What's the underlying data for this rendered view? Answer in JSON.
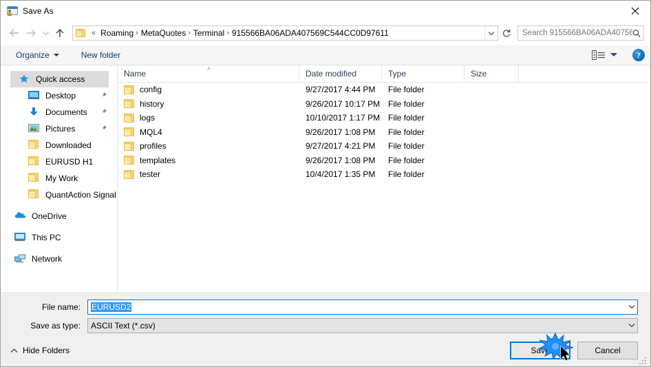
{
  "window": {
    "title": "Save As",
    "icon": "save-as-icon",
    "close_label": "✕"
  },
  "navigation": {
    "back_icon": "arrow-left-icon",
    "forward_icon": "arrow-right-icon",
    "recent_icon": "chevron-down-icon",
    "up_icon": "arrow-up-icon",
    "address": {
      "folder_icon": "folder-icon",
      "prefix": "«",
      "crumbs": [
        "Roaming",
        "MetaQuotes",
        "Terminal",
        "915566BA06ADA407569C544CC0D97611"
      ],
      "separator": "›",
      "dropdown_icon": "chevron-down-icon"
    },
    "refresh_icon": "refresh-icon",
    "search": {
      "placeholder": "Search 915566BA06ADA40756...",
      "icon": "search-icon"
    }
  },
  "toolbar": {
    "organize_label": "Organize",
    "new_folder_label": "New folder",
    "view_icon": "view-details-icon",
    "view_dropdown_icon": "chevron-down-icon",
    "help_label": "?"
  },
  "sidebar": {
    "items": [
      {
        "label": "Quick access",
        "icon": "star-icon",
        "selected": true,
        "indent": false,
        "pinned": false
      },
      {
        "label": "Desktop",
        "icon": "desktop-icon",
        "selected": false,
        "indent": true,
        "pinned": true
      },
      {
        "label": "Documents",
        "icon": "documents-download-icon",
        "selected": false,
        "indent": true,
        "pinned": true
      },
      {
        "label": "Pictures",
        "icon": "pictures-icon",
        "selected": false,
        "indent": true,
        "pinned": true
      },
      {
        "label": "Downloaded",
        "icon": "folder-icon",
        "selected": false,
        "indent": true,
        "pinned": false
      },
      {
        "label": "EURUSD H1",
        "icon": "folder-icon",
        "selected": false,
        "indent": true,
        "pinned": false
      },
      {
        "label": "My Work",
        "icon": "folder-icon",
        "selected": false,
        "indent": true,
        "pinned": false
      },
      {
        "label": "QuantAction Signal",
        "icon": "folder-icon",
        "selected": false,
        "indent": true,
        "pinned": false
      },
      {
        "label": "OneDrive",
        "icon": "onedrive-icon",
        "selected": false,
        "indent": false,
        "pinned": false
      },
      {
        "label": "This PC",
        "icon": "this-pc-icon",
        "selected": false,
        "indent": false,
        "pinned": false
      },
      {
        "label": "Network",
        "icon": "network-icon",
        "selected": false,
        "indent": false,
        "pinned": false
      }
    ]
  },
  "filelist": {
    "columns": [
      "Name",
      "Date modified",
      "Type",
      "Size"
    ],
    "sort_indicator": "˄",
    "rows": [
      {
        "name": "config",
        "date": "9/27/2017 4:44 PM",
        "type": "File folder",
        "size": ""
      },
      {
        "name": "history",
        "date": "9/26/2017 10:17 PM",
        "type": "File folder",
        "size": ""
      },
      {
        "name": "logs",
        "date": "10/10/2017 1:17 PM",
        "type": "File folder",
        "size": ""
      },
      {
        "name": "MQL4",
        "date": "9/26/2017 1:08 PM",
        "type": "File folder",
        "size": ""
      },
      {
        "name": "profiles",
        "date": "9/27/2017 4:21 PM",
        "type": "File folder",
        "size": ""
      },
      {
        "name": "templates",
        "date": "9/26/2017 1:08 PM",
        "type": "File folder",
        "size": ""
      },
      {
        "name": "tester",
        "date": "10/4/2017 1:35 PM",
        "type": "File folder",
        "size": ""
      }
    ]
  },
  "footer": {
    "filename_label": "File name:",
    "filename_value": "EURUSD2",
    "filetype_label": "Save as type:",
    "filetype_value": "ASCII Text (*.csv)",
    "hide_folders_label": "Hide Folders",
    "hide_folders_icon": "chevron-up-icon",
    "save_label": "Save",
    "cancel_label": "Cancel"
  },
  "colors": {
    "accent": "#0078d7",
    "folder": "#fbd572",
    "selection": "#3399ff",
    "header_text": "#2e3c50"
  }
}
